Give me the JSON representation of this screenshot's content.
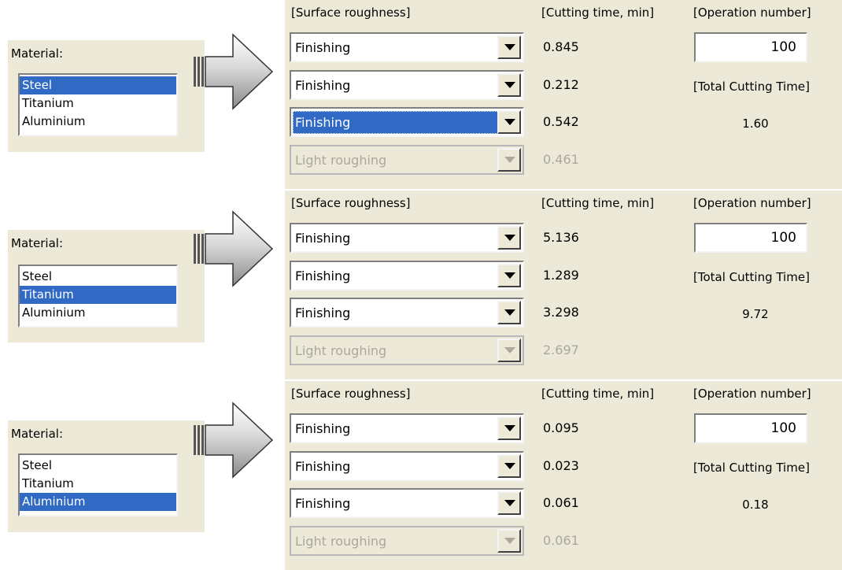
{
  "examples": [
    {
      "material_label": "Material:",
      "materials": [
        {
          "name": "Steel",
          "selected": true
        },
        {
          "name": "Titanium",
          "selected": false
        },
        {
          "name": "Aluminium",
          "selected": false
        }
      ],
      "headers": {
        "surface": "[Surface roughness]",
        "time": "[Cutting time, min]",
        "operation": "[Operation number]"
      },
      "rows": [
        {
          "roughness": "Finishing",
          "time": "0.845",
          "disabled": false,
          "focused": false
        },
        {
          "roughness": "Finishing",
          "time": "0.212",
          "disabled": false,
          "focused": false
        },
        {
          "roughness": "Finishing",
          "time": "0.542",
          "disabled": false,
          "focused": true
        },
        {
          "roughness": "Light roughing",
          "time": "0.461",
          "disabled": true,
          "focused": false
        }
      ],
      "operation_number": "100",
      "total_label": "[Total Cutting Time]",
      "total_value": "1.60"
    },
    {
      "material_label": "Material:",
      "materials": [
        {
          "name": "Steel",
          "selected": false
        },
        {
          "name": "Titanium",
          "selected": true
        },
        {
          "name": "Aluminium",
          "selected": false
        }
      ],
      "headers": {
        "surface": "[Surface roughness]",
        "time": "[Cutting time, min]",
        "operation": "[Operation number]"
      },
      "rows": [
        {
          "roughness": "Finishing",
          "time": "5.136",
          "disabled": false,
          "focused": false
        },
        {
          "roughness": "Finishing",
          "time": "1.289",
          "disabled": false,
          "focused": false
        },
        {
          "roughness": "Finishing",
          "time": "3.298",
          "disabled": false,
          "focused": false
        },
        {
          "roughness": "Light roughing",
          "time": "2.697",
          "disabled": true,
          "focused": false
        }
      ],
      "operation_number": "100",
      "total_label": "[Total Cutting Time]",
      "total_value": "9.72"
    },
    {
      "material_label": "Material:",
      "materials": [
        {
          "name": "Steel",
          "selected": false
        },
        {
          "name": "Titanium",
          "selected": false
        },
        {
          "name": "Aluminium",
          "selected": true
        }
      ],
      "headers": {
        "surface": "[Surface roughness]",
        "time": "[Cutting time, min]",
        "operation": "[Operation number]"
      },
      "rows": [
        {
          "roughness": "Finishing",
          "time": "0.095",
          "disabled": false,
          "focused": false
        },
        {
          "roughness": "Finishing",
          "time": "0.023",
          "disabled": false,
          "focused": false
        },
        {
          "roughness": "Finishing",
          "time": "0.061",
          "disabled": false,
          "focused": false
        },
        {
          "roughness": "Light roughing",
          "time": "0.061",
          "disabled": true,
          "focused": false
        }
      ],
      "operation_number": "100",
      "total_label": "[Total Cutting Time]",
      "total_value": "0.18"
    }
  ],
  "colors": {
    "panel_bg": "#ece9d8",
    "selection": "#316ac5",
    "disabled_text": "#aca899"
  },
  "icons": {
    "arrow": "right-arrow-icon",
    "dropdown": "chevron-down-icon"
  }
}
